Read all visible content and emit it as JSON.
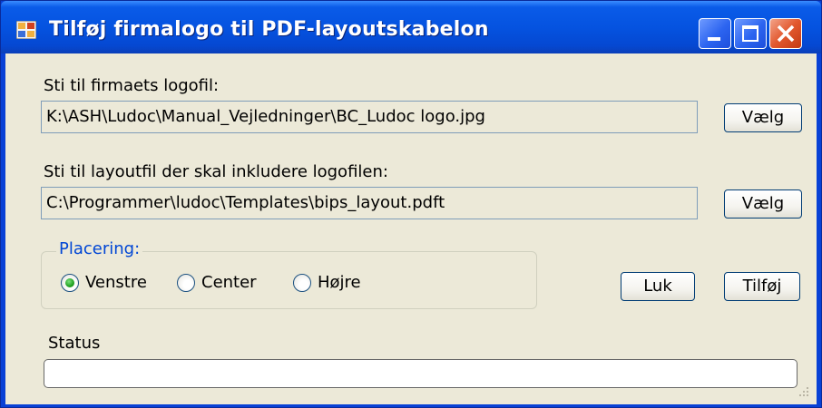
{
  "window": {
    "title": "Tilføj firmalogo til PDF-layoutskabelon"
  },
  "logo_file": {
    "label": "Sti til firmaets logofil:",
    "value": "K:\\ASH\\Ludoc\\Manual_Vejledninger\\BC_Ludoc logo.jpg",
    "browse_label": "Vælg"
  },
  "layout_file": {
    "label": "Sti til layoutfil der skal inkludere logofilen:",
    "value": "C:\\Programmer\\ludoc\\Templates\\bips_layout.pdft",
    "browse_label": "Vælg"
  },
  "placement": {
    "legend": "Placering:",
    "options": [
      {
        "label": "Venstre",
        "selected": true
      },
      {
        "label": "Center",
        "selected": false
      },
      {
        "label": "Højre",
        "selected": false
      }
    ]
  },
  "buttons": {
    "close_label": "Luk",
    "add_label": "Tilføj"
  },
  "status": {
    "label": "Status",
    "progress": 0
  },
  "colors": {
    "titlebar": "#0553e0",
    "client_bg": "#ece9d8",
    "group_legend": "#0046d5",
    "radio_selected": "#21a121"
  }
}
